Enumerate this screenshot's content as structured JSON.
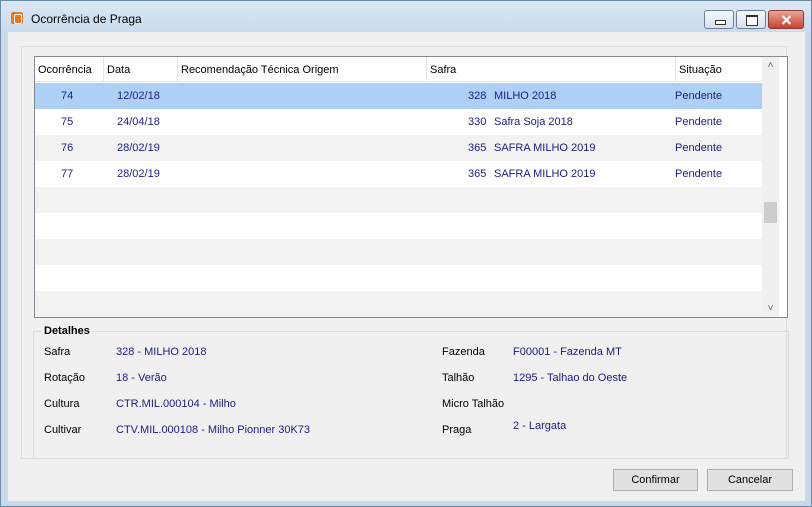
{
  "window": {
    "title": "Ocorrência de Praga"
  },
  "grid": {
    "columns": [
      "Ocorrência",
      "Data",
      "Recomendação Técnica Origem",
      "Safra",
      "Situação"
    ],
    "rows": [
      {
        "ocorrencia": "74",
        "data": "12/02/18",
        "recomendacao": "",
        "safra_code": "328",
        "safra_name": "MILHO 2018",
        "situacao": "Pendente"
      },
      {
        "ocorrencia": "75",
        "data": "24/04/18",
        "recomendacao": "",
        "safra_code": "330",
        "safra_name": "Safra Soja 2018",
        "situacao": "Pendente"
      },
      {
        "ocorrencia": "76",
        "data": "28/02/19",
        "recomendacao": "",
        "safra_code": "365",
        "safra_name": "SAFRA MILHO 2019",
        "situacao": "Pendente"
      },
      {
        "ocorrencia": "77",
        "data": "28/02/19",
        "recomendacao": "",
        "safra_code": "365",
        "safra_name": "SAFRA MILHO 2019",
        "situacao": "Pendente"
      }
    ],
    "selected_row": 0,
    "scroll_up_icon": "chevron-up-icon",
    "scroll_down_icon": "chevron-down-icon"
  },
  "details": {
    "title": "Detalhes",
    "safra_label": "Safra",
    "safra_value": "328 - MILHO 2018",
    "rotacao_label": "Rotação",
    "rotacao_value": "18 - Verão",
    "cultura_label": "Cultura",
    "cultura_value": "CTR.MIL.000104 - Milho",
    "cultivar_label": "Cultivar",
    "cultivar_value": "CTV.MIL.000108 - Milho Pionner 30K73",
    "fazenda_label": "Fazenda",
    "fazenda_value": "F00001 - Fazenda MT",
    "talhao_label": "Talhão",
    "talhao_value": "1295 - Talhao do Oeste",
    "micro_talhao_label": "Micro Talhão",
    "micro_talhao_value": "",
    "praga_label": "Praga",
    "praga_value": "2 - Largata"
  },
  "buttons": {
    "confirm": "Confirmar",
    "cancel": "Cancelar"
  },
  "colors": {
    "selected_row": "#aed0f5",
    "value_text": "#1c1c85"
  }
}
